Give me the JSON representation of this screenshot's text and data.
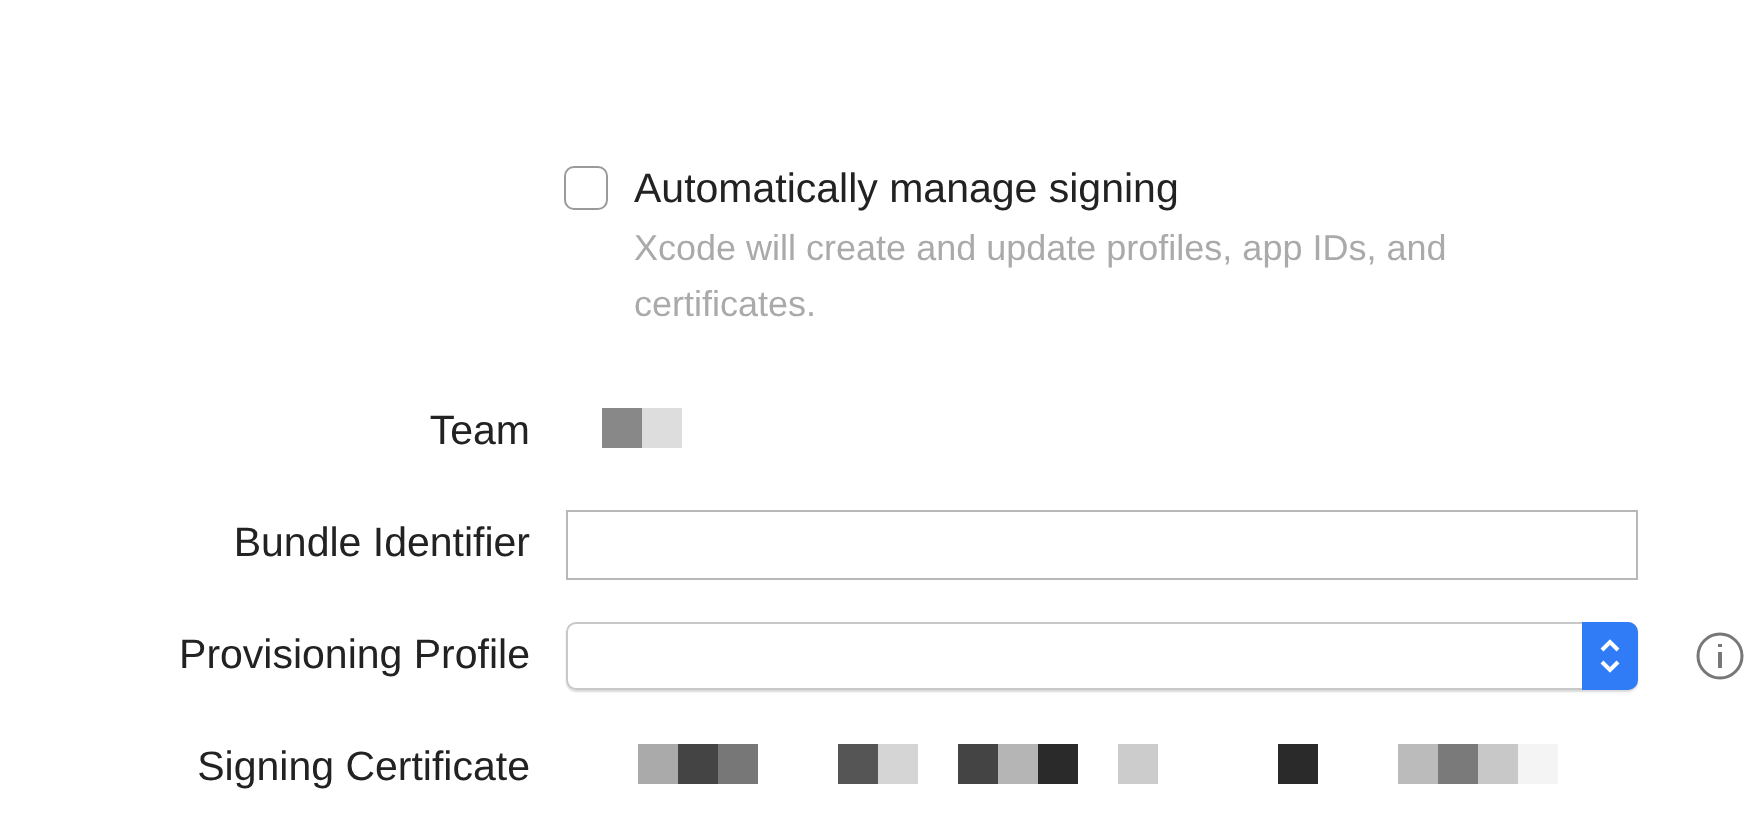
{
  "signing": {
    "automatic": {
      "label": "Automatically manage signing",
      "checked": false,
      "hint": "Xcode will create and update profiles, app IDs, and certificates."
    }
  },
  "rows": [
    {
      "kind": "redacted",
      "label": "Team"
    },
    {
      "kind": "field",
      "label": "Bundle Identifier"
    },
    {
      "kind": "popup",
      "label": "Provisioning Profile"
    },
    {
      "kind": "redacted",
      "label": "Signing Certificate"
    }
  ]
}
